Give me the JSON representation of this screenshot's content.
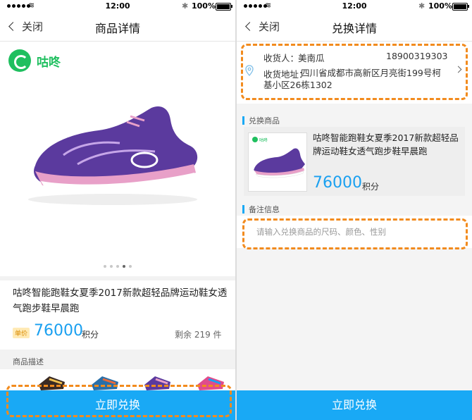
{
  "status": {
    "time": "12:00",
    "battery": "100%"
  },
  "left": {
    "nav": {
      "back_label": "关闭",
      "title": "商品详情"
    },
    "brand": "咕咚",
    "product": {
      "title": "咕咚智能跑鞋女夏季2017新款超轻品牌运动鞋女透气跑步鞋早晨跑",
      "price_tag": "单价",
      "price": "76000",
      "unit": "积分",
      "stock": "剩余 219 件"
    },
    "pager": {
      "count": 5,
      "active": 4
    },
    "desc_label": "商品描述",
    "cta": "立即兑换"
  },
  "right": {
    "nav": {
      "back_label": "关闭",
      "title": "兑换详情"
    },
    "address": {
      "recipient_label": "收货人：",
      "recipient": "美南瓜",
      "phone": "18900319303",
      "address_label": "收货地址：",
      "address": "四川省成都市高新区月亮街199号柯基小区26栋1302"
    },
    "goods_section": "兑换商品",
    "goods": {
      "brand": "咕咚",
      "title": "咕咚智能跑鞋女夏季2017新款超轻品牌运动鞋女透气跑步鞋早晨跑",
      "price": "76000",
      "unit": "积分"
    },
    "note_section": "备注信息",
    "note_placeholder": "请输入兑换商品的尺码、颜色、性别",
    "cta": "立即兑换"
  },
  "colors": {
    "accent": "#19a9f5",
    "highlight": "#f28b1e",
    "brand_green": "#1fbf5f"
  }
}
